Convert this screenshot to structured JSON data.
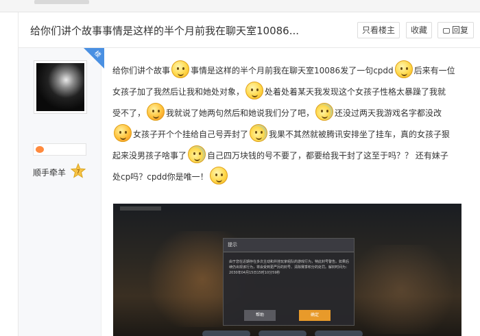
{
  "thread": {
    "title": "给你们讲个故事事情是这样的半个月前我在聊天室10086...",
    "buttons": {
      "only_lz": "只看楼主",
      "favorite": "收藏",
      "reply": "回复"
    }
  },
  "author": {
    "name": "顺手牵羊",
    "corner_label": "楼主",
    "level": "7"
  },
  "post": {
    "lines": [
      [
        "给你们讲个故事",
        "事情是这样的半个月前我在聊天室10086发了一句cpdd",
        "后来有一位"
      ],
      [
        "女孩子加了我然后让我和她处对象，",
        "处着处着某天我发现这个女孩子性格太暴躁了我就"
      ],
      [
        "受不了，",
        "我就说了她两句然后和她说我们分了吧，",
        "还没过两天我游戏名字都没改"
      ],
      [
        "女孩子开个个挂给自己号弄封了",
        "我果不其然就被腾讯安排坐了挂车，真的女孩子狠"
      ],
      [
        "起来没男孩子啥事了",
        "自己四万块钱的号不要了，都要给我干封了这至于吗？？ 还有妹子"
      ],
      [
        "处cp吗？cpdd你是唯一！"
      ]
    ]
  },
  "screenshot_dialog": {
    "title": "提示",
    "body": "由于您在近期存在多次主动和并挂玩家组队的游戏行为，特此封号警告。如果后续仍出现该行为，将会受到更严厉的封号、清除赛季积分的处罚。解封时间为：2030年04月15日15时10分59秒",
    "help": "帮助",
    "ok": "确定"
  },
  "icons": [
    "reply-icon",
    "user-avatar",
    "badge-icon",
    "level-icon",
    "emoji-icon"
  ]
}
